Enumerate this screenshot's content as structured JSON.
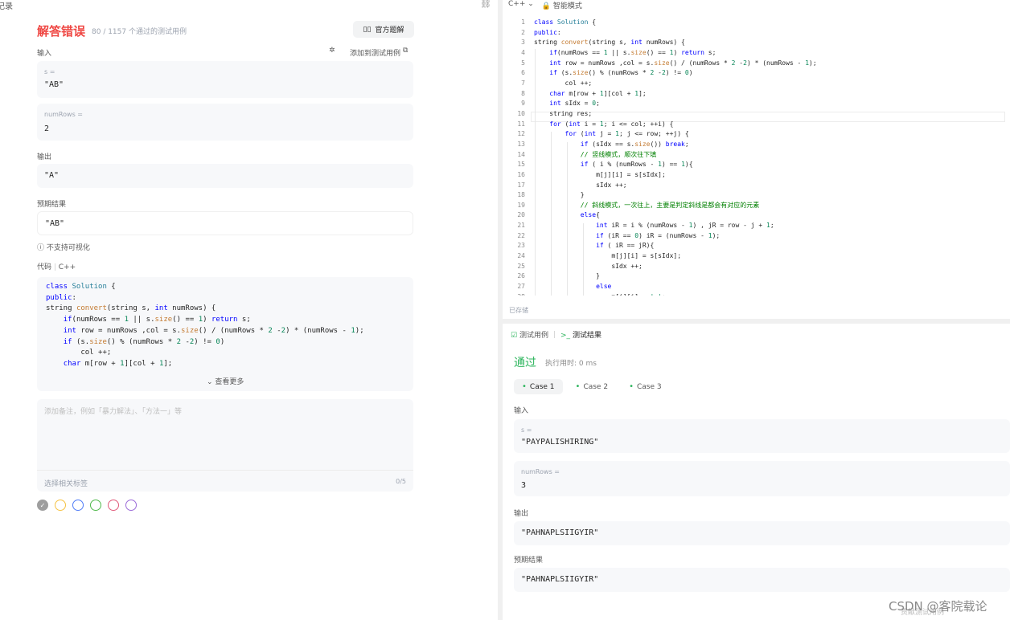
{
  "left": {
    "top_label": "提交记录",
    "title": "解答错误",
    "subtitle": "80 / 1157 个通过的测试用例",
    "solution_button": "官方题解",
    "input_label": "输入",
    "add_case_label": "添加到测试用例",
    "input_s_key": "s =",
    "input_s_value": "\"AB\"",
    "input_rows_key": "numRows =",
    "input_rows_value": "2",
    "output_label": "输出",
    "output_value": "\"A\"",
    "expected_label": "预期结果",
    "expected_value": "\"AB\"",
    "no_visual": "不支持可视化",
    "code_label": "代码",
    "code_lang": "C++",
    "see_more": "查看更多",
    "note_placeholder": "添加备注，例如「暴力解法」、「方法一」等",
    "tag_placeholder": "选择相关标签",
    "tag_count": "0/5",
    "colors": [
      "#9e9e9e",
      "#f5c242",
      "#4f7cf7",
      "#4fb84a",
      "#e05a7a",
      "#9b6ad8"
    ]
  },
  "right": {
    "lang": "C++",
    "mode": "智能模式",
    "saved": "已存储",
    "tab_testcase": "测试用例",
    "tab_result": "测试结果",
    "status": "通过",
    "runtime": "执行用时: 0 ms",
    "cases": [
      "Case 1",
      "Case 2",
      "Case 3"
    ],
    "input_label": "输入",
    "s_key": "s =",
    "s_value": "\"PAYPALISHIRING\"",
    "rows_key": "numRows =",
    "rows_value": "3",
    "output_label": "输出",
    "output_value": "\"PAHNAPLSIIGYIR\"",
    "expected_label": "预期结果",
    "expected_value": "\"PAHNAPLSIIGYIR\"",
    "contribute": "贡献测试用例"
  },
  "watermark": "CSDN @客院载论"
}
